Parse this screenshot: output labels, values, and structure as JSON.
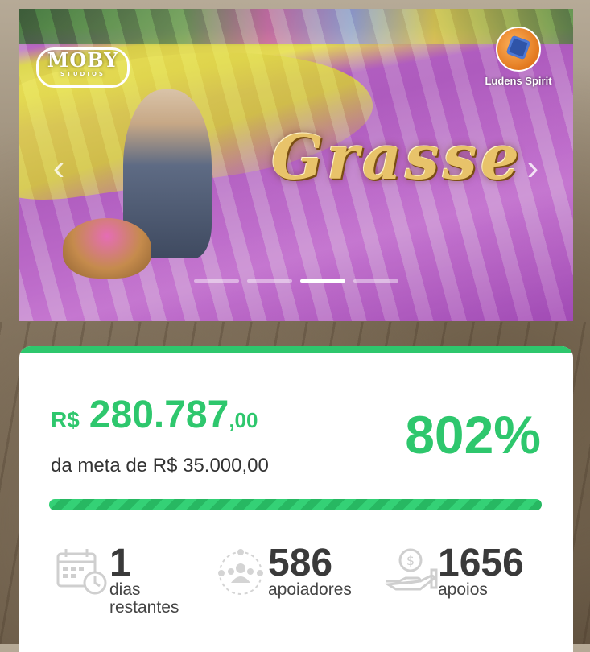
{
  "hero": {
    "left_logo": {
      "text": "MOBY",
      "subtext": "STUDIOS"
    },
    "right_logo": {
      "text": "Ludens Spirit"
    },
    "title": "Grasse",
    "slides_total": 4,
    "active_slide": 3
  },
  "funding": {
    "currency_symbol": "R$",
    "amount_main": "280.787",
    "amount_cents": ",00",
    "goal_text": "da meta de R$ 35.000,00",
    "percent_text": "802%",
    "progress_fraction": 1.0
  },
  "stats": [
    {
      "value": "1",
      "label_line1": "dias",
      "label_line2": "restantes",
      "icon": "calendar-clock-icon"
    },
    {
      "value": "586",
      "label_line1": "apoiadores",
      "label_line2": "",
      "icon": "people-group-icon"
    },
    {
      "value": "1656",
      "label_line1": "apoios",
      "label_line2": "",
      "icon": "hand-coin-icon"
    }
  ],
  "colors": {
    "accent": "#2ec76d",
    "text_dark": "#333333"
  }
}
